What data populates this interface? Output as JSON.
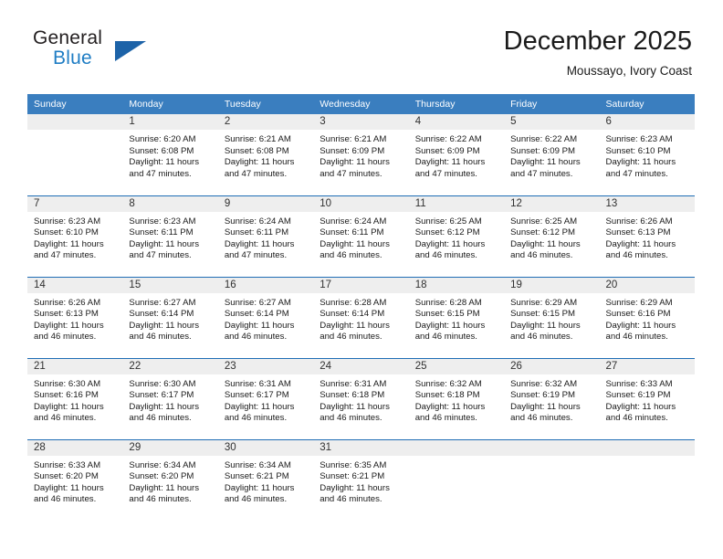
{
  "brand": {
    "word_one": "General",
    "word_two": "Blue",
    "flag_icon": "blue-triangle-flag",
    "color_dark": "#231f20",
    "color_blue": "#1f7dc4"
  },
  "header": {
    "title": "December 2025",
    "subtitle": "Moussayo, Ivory Coast"
  },
  "colors": {
    "header_row_bg": "#3a7ebf",
    "header_row_text": "#ffffff",
    "daynum_bg": "#eeeeee",
    "week_border": "#1f6db5",
    "body_text": "#1a1a1a"
  },
  "calendar": {
    "weekday_headers": [
      "Sunday",
      "Monday",
      "Tuesday",
      "Wednesday",
      "Thursday",
      "Friday",
      "Saturday"
    ],
    "labels": {
      "sunrise": "Sunrise:",
      "sunset": "Sunset:",
      "daylight": "Daylight:"
    },
    "weeks": [
      [
        {
          "day": "",
          "lines": []
        },
        {
          "day": "1",
          "lines": [
            "Sunrise: 6:20 AM",
            "Sunset: 6:08 PM",
            "Daylight: 11 hours",
            "and 47 minutes."
          ]
        },
        {
          "day": "2",
          "lines": [
            "Sunrise: 6:21 AM",
            "Sunset: 6:08 PM",
            "Daylight: 11 hours",
            "and 47 minutes."
          ]
        },
        {
          "day": "3",
          "lines": [
            "Sunrise: 6:21 AM",
            "Sunset: 6:09 PM",
            "Daylight: 11 hours",
            "and 47 minutes."
          ]
        },
        {
          "day": "4",
          "lines": [
            "Sunrise: 6:22 AM",
            "Sunset: 6:09 PM",
            "Daylight: 11 hours",
            "and 47 minutes."
          ]
        },
        {
          "day": "5",
          "lines": [
            "Sunrise: 6:22 AM",
            "Sunset: 6:09 PM",
            "Daylight: 11 hours",
            "and 47 minutes."
          ]
        },
        {
          "day": "6",
          "lines": [
            "Sunrise: 6:23 AM",
            "Sunset: 6:10 PM",
            "Daylight: 11 hours",
            "and 47 minutes."
          ]
        }
      ],
      [
        {
          "day": "7",
          "lines": [
            "Sunrise: 6:23 AM",
            "Sunset: 6:10 PM",
            "Daylight: 11 hours",
            "and 47 minutes."
          ]
        },
        {
          "day": "8",
          "lines": [
            "Sunrise: 6:23 AM",
            "Sunset: 6:11 PM",
            "Daylight: 11 hours",
            "and 47 minutes."
          ]
        },
        {
          "day": "9",
          "lines": [
            "Sunrise: 6:24 AM",
            "Sunset: 6:11 PM",
            "Daylight: 11 hours",
            "and 47 minutes."
          ]
        },
        {
          "day": "10",
          "lines": [
            "Sunrise: 6:24 AM",
            "Sunset: 6:11 PM",
            "Daylight: 11 hours",
            "and 46 minutes."
          ]
        },
        {
          "day": "11",
          "lines": [
            "Sunrise: 6:25 AM",
            "Sunset: 6:12 PM",
            "Daylight: 11 hours",
            "and 46 minutes."
          ]
        },
        {
          "day": "12",
          "lines": [
            "Sunrise: 6:25 AM",
            "Sunset: 6:12 PM",
            "Daylight: 11 hours",
            "and 46 minutes."
          ]
        },
        {
          "day": "13",
          "lines": [
            "Sunrise: 6:26 AM",
            "Sunset: 6:13 PM",
            "Daylight: 11 hours",
            "and 46 minutes."
          ]
        }
      ],
      [
        {
          "day": "14",
          "lines": [
            "Sunrise: 6:26 AM",
            "Sunset: 6:13 PM",
            "Daylight: 11 hours",
            "and 46 minutes."
          ]
        },
        {
          "day": "15",
          "lines": [
            "Sunrise: 6:27 AM",
            "Sunset: 6:14 PM",
            "Daylight: 11 hours",
            "and 46 minutes."
          ]
        },
        {
          "day": "16",
          "lines": [
            "Sunrise: 6:27 AM",
            "Sunset: 6:14 PM",
            "Daylight: 11 hours",
            "and 46 minutes."
          ]
        },
        {
          "day": "17",
          "lines": [
            "Sunrise: 6:28 AM",
            "Sunset: 6:14 PM",
            "Daylight: 11 hours",
            "and 46 minutes."
          ]
        },
        {
          "day": "18",
          "lines": [
            "Sunrise: 6:28 AM",
            "Sunset: 6:15 PM",
            "Daylight: 11 hours",
            "and 46 minutes."
          ]
        },
        {
          "day": "19",
          "lines": [
            "Sunrise: 6:29 AM",
            "Sunset: 6:15 PM",
            "Daylight: 11 hours",
            "and 46 minutes."
          ]
        },
        {
          "day": "20",
          "lines": [
            "Sunrise: 6:29 AM",
            "Sunset: 6:16 PM",
            "Daylight: 11 hours",
            "and 46 minutes."
          ]
        }
      ],
      [
        {
          "day": "21",
          "lines": [
            "Sunrise: 6:30 AM",
            "Sunset: 6:16 PM",
            "Daylight: 11 hours",
            "and 46 minutes."
          ]
        },
        {
          "day": "22",
          "lines": [
            "Sunrise: 6:30 AM",
            "Sunset: 6:17 PM",
            "Daylight: 11 hours",
            "and 46 minutes."
          ]
        },
        {
          "day": "23",
          "lines": [
            "Sunrise: 6:31 AM",
            "Sunset: 6:17 PM",
            "Daylight: 11 hours",
            "and 46 minutes."
          ]
        },
        {
          "day": "24",
          "lines": [
            "Sunrise: 6:31 AM",
            "Sunset: 6:18 PM",
            "Daylight: 11 hours",
            "and 46 minutes."
          ]
        },
        {
          "day": "25",
          "lines": [
            "Sunrise: 6:32 AM",
            "Sunset: 6:18 PM",
            "Daylight: 11 hours",
            "and 46 minutes."
          ]
        },
        {
          "day": "26",
          "lines": [
            "Sunrise: 6:32 AM",
            "Sunset: 6:19 PM",
            "Daylight: 11 hours",
            "and 46 minutes."
          ]
        },
        {
          "day": "27",
          "lines": [
            "Sunrise: 6:33 AM",
            "Sunset: 6:19 PM",
            "Daylight: 11 hours",
            "and 46 minutes."
          ]
        }
      ],
      [
        {
          "day": "28",
          "lines": [
            "Sunrise: 6:33 AM",
            "Sunset: 6:20 PM",
            "Daylight: 11 hours",
            "and 46 minutes."
          ]
        },
        {
          "day": "29",
          "lines": [
            "Sunrise: 6:34 AM",
            "Sunset: 6:20 PM",
            "Daylight: 11 hours",
            "and 46 minutes."
          ]
        },
        {
          "day": "30",
          "lines": [
            "Sunrise: 6:34 AM",
            "Sunset: 6:21 PM",
            "Daylight: 11 hours",
            "and 46 minutes."
          ]
        },
        {
          "day": "31",
          "lines": [
            "Sunrise: 6:35 AM",
            "Sunset: 6:21 PM",
            "Daylight: 11 hours",
            "and 46 minutes."
          ]
        },
        {
          "day": "",
          "lines": []
        },
        {
          "day": "",
          "lines": []
        },
        {
          "day": "",
          "lines": []
        }
      ]
    ]
  }
}
